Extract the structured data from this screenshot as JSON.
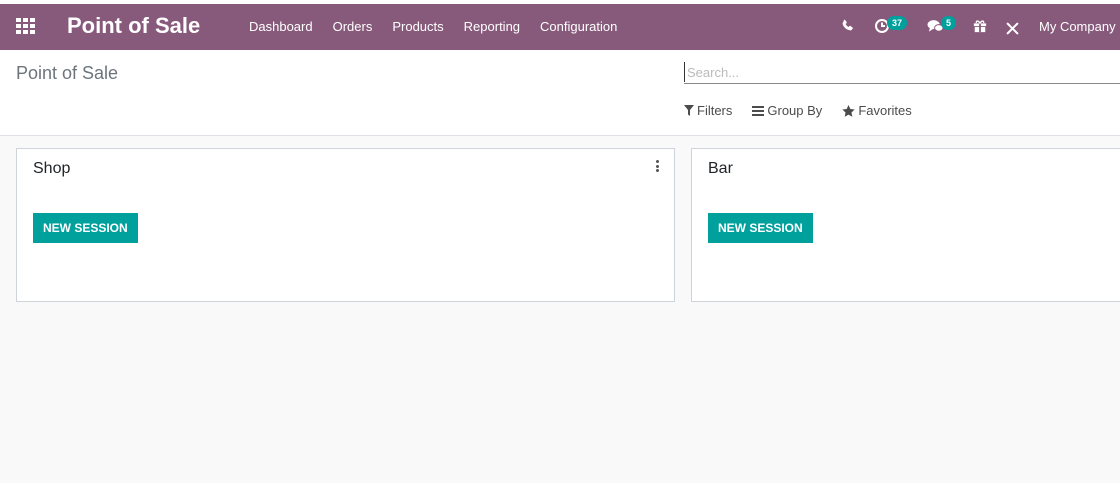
{
  "app": {
    "title": "Point of Sale"
  },
  "menu": {
    "items": [
      {
        "label": "Dashboard"
      },
      {
        "label": "Orders"
      },
      {
        "label": "Products"
      },
      {
        "label": "Reporting"
      },
      {
        "label": "Configuration"
      }
    ]
  },
  "systray": {
    "activities_count": "37",
    "messages_count": "5",
    "company": "My Company ("
  },
  "control_panel": {
    "breadcrumb": "Point of Sale",
    "search_placeholder": "Search...",
    "filters_label": "Filters",
    "groupby_label": "Group By",
    "favorites_label": "Favorites"
  },
  "kanban": {
    "cards": [
      {
        "title": "Shop",
        "button": "NEW SESSION"
      },
      {
        "title": "Bar",
        "button": "NEW SESSION"
      }
    ]
  },
  "colors": {
    "topbar": "#875a7b",
    "accent": "#00a09d"
  }
}
